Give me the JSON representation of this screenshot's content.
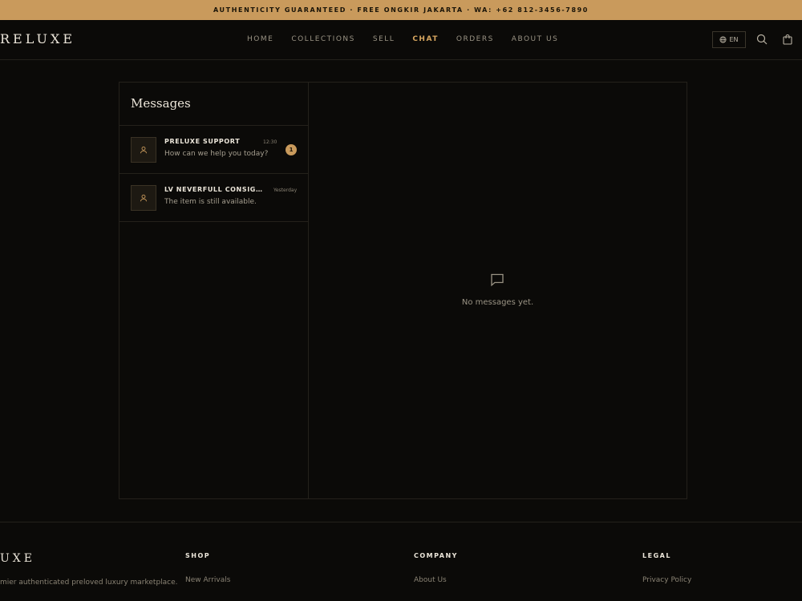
{
  "announcement": "AUTHENTICITY GUARANTEED · FREE ONGKIR JAKARTA · WA: +62 812-3456-7890",
  "header": {
    "logo": "RELUXE",
    "nav": [
      {
        "label": "HOME"
      },
      {
        "label": "COLLECTIONS"
      },
      {
        "label": "SELL"
      },
      {
        "label": "CHAT",
        "active": true
      },
      {
        "label": "ORDERS"
      },
      {
        "label": "ABOUT US"
      }
    ],
    "language": "EN",
    "icons": [
      "globe-icon",
      "search-icon",
      "cart-icon"
    ]
  },
  "messages": {
    "title": "Messages",
    "conversations": [
      {
        "name": "PRELUXE SUPPORT",
        "time": "12:30",
        "preview": "How can we help you today?",
        "unread": "1"
      },
      {
        "name": "LV NEVERFULL CONSIGN...",
        "time": "Yesterday",
        "preview": "The item is still available."
      }
    ],
    "empty_text": "No messages yet."
  },
  "footer": {
    "logo": "UXE",
    "tagline": "mier authenticated preloved luxury marketplace.",
    "columns": [
      {
        "heading": "SHOP",
        "links": [
          "New Arrivals"
        ]
      },
      {
        "heading": "COMPANY",
        "links": [
          "About Us"
        ]
      },
      {
        "heading": "LEGAL",
        "links": [
          "Privacy Policy"
        ]
      }
    ]
  },
  "colors": {
    "accent": "#c99a5c",
    "background": "#0b0a08",
    "border": "#24211b"
  }
}
